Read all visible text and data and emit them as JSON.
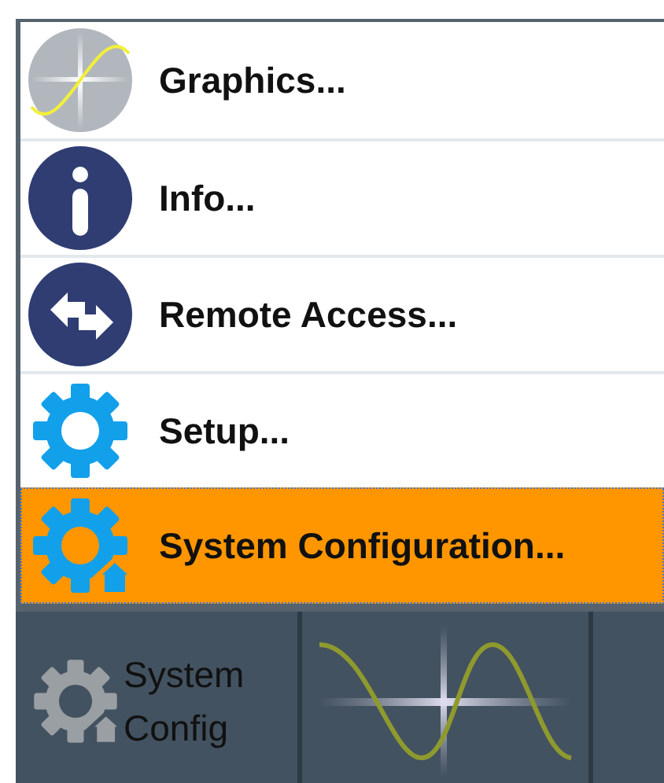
{
  "menu": {
    "items": [
      {
        "label": "Graphics...",
        "kind": "graphics",
        "selected": false
      },
      {
        "label": "Info...",
        "kind": "info",
        "selected": false
      },
      {
        "label": "Remote Access...",
        "kind": "remote",
        "selected": false
      },
      {
        "label": "Setup...",
        "kind": "setup",
        "selected": false
      },
      {
        "label": "System Configuration...",
        "kind": "sysconfig",
        "selected": true
      }
    ]
  },
  "taskbar": {
    "items": [
      {
        "kind": "sysconfig",
        "label": "System Config"
      },
      {
        "kind": "graphics"
      }
    ]
  }
}
